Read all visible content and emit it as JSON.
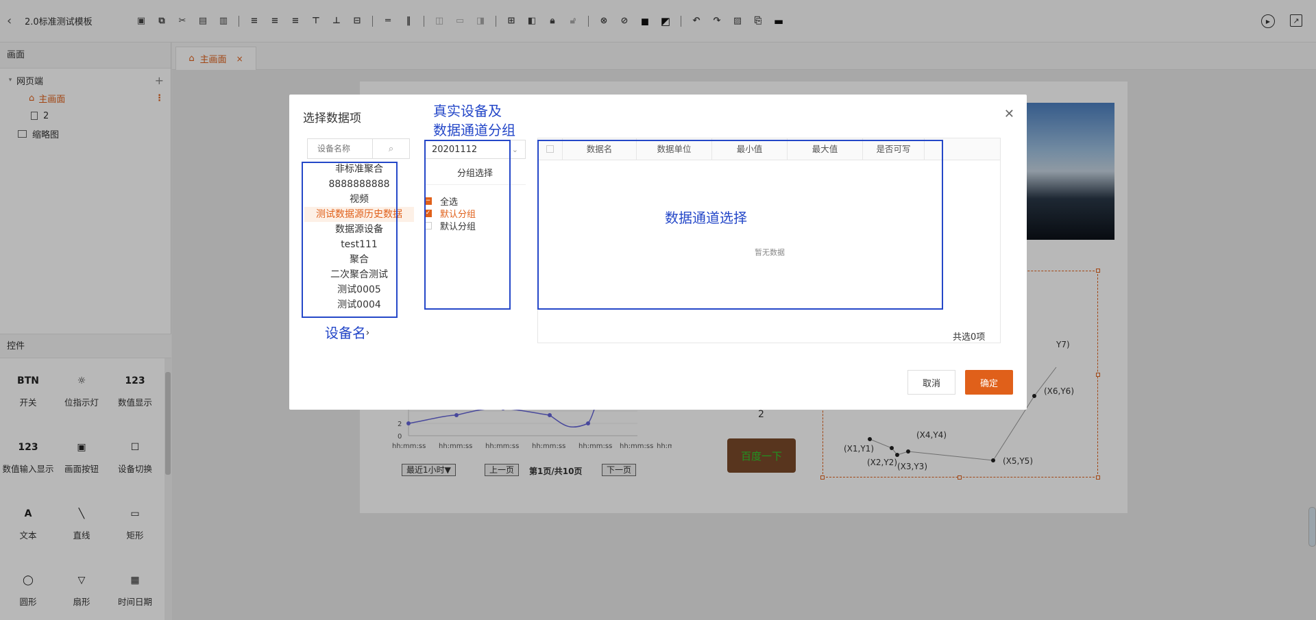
{
  "app": {
    "title": "2.0标准测试模板"
  },
  "left_panel": {
    "screens_header": "画面",
    "tree": [
      {
        "label": "网页端",
        "level": 0
      },
      {
        "label": "主画面",
        "level": 1
      },
      {
        "label": "2",
        "level": 1
      },
      {
        "label": "缩略图",
        "level": 0
      }
    ],
    "controls_header": "控件",
    "controls": [
      {
        "label": "开关",
        "icon": "btn-switch-icon",
        "glyph": "BTN"
      },
      {
        "label": "位指示灯",
        "icon": "bulb-icon",
        "glyph": "☼"
      },
      {
        "label": "数值显示",
        "icon": "number-display-icon",
        "glyph": "123"
      },
      {
        "label": "数值输入显示",
        "icon": "number-input-icon",
        "glyph": "123"
      },
      {
        "label": "画面按钮",
        "icon": "screen-button-icon",
        "glyph": "▣"
      },
      {
        "label": "设备切换",
        "icon": "device-switch-icon",
        "glyph": "☐"
      },
      {
        "label": "文本",
        "icon": "text-icon",
        "glyph": "A"
      },
      {
        "label": "直线",
        "icon": "line-icon",
        "glyph": "╲"
      },
      {
        "label": "矩形",
        "icon": "rect-icon",
        "glyph": "▭"
      },
      {
        "label": "圆形",
        "icon": "circle-icon",
        "glyph": "◯"
      },
      {
        "label": "扇形",
        "icon": "sector-icon",
        "glyph": "▽"
      },
      {
        "label": "时间日期",
        "icon": "calendar-icon",
        "glyph": "▦"
      }
    ]
  },
  "tab": {
    "label": "主画面",
    "close": "×"
  },
  "canvas": {
    "num_label": "2",
    "baidu_button": "百度一下",
    "chart": {
      "y_ticks": [
        "2",
        "0"
      ],
      "x_ticks": [
        "hh:mm:ss",
        "hh:mm:ss",
        "hh:mm:ss",
        "hh:mm:ss",
        "hh:mm:ss",
        "hh:mm:ss",
        "hh:mm:ss"
      ],
      "range_select": "最近1小时▼",
      "prev": "上一页",
      "page_info": "第1页/共10页",
      "next": "下一页"
    },
    "scatter_labels": [
      "(X1,Y1)",
      "(X2,Y2)",
      "(X3,Y3)",
      "(X4,Y4)",
      "(X5,Y5)",
      "(X6,Y6)",
      "Y7)"
    ]
  },
  "modal": {
    "title": "选择数据项",
    "search_placeholder": "设备名称",
    "devices": [
      "非标准聚合",
      "8888888888",
      "视频",
      "测试数据源历史数据",
      "数据源设备",
      "test111",
      "聚合",
      "二次聚合测试",
      "测试0005",
      "测试0004"
    ],
    "selected_device_index": 3,
    "pager": {
      "prev": "‹",
      "next": "›"
    },
    "group_select_value": "20201112",
    "group_header": "分组选择",
    "groups": [
      {
        "label": "全选",
        "state": "partial"
      },
      {
        "label": "默认分组",
        "state": "checked"
      },
      {
        "label": "默认分组",
        "state": "unchecked"
      }
    ],
    "table_headers": [
      "数据名",
      "数据单位",
      "最小值",
      "最大值",
      "是否可写"
    ],
    "empty_text": "暂无数据",
    "total_text": "共选0项",
    "cancel": "取消",
    "confirm": "确定",
    "annotations": {
      "group_title": "真实设备及\n数据通道分组",
      "device_name": "设备名",
      "channel_select": "数据通道选择"
    }
  },
  "colors": {
    "accent": "#e0601a",
    "annotation": "#2447c8"
  }
}
